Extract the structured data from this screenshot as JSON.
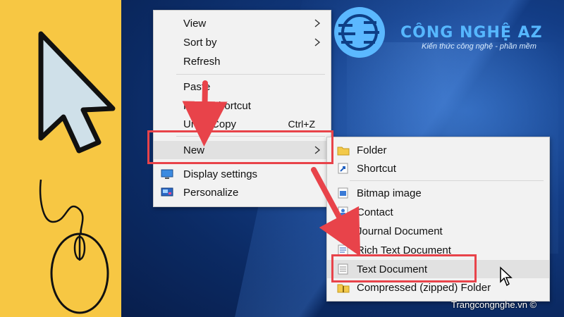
{
  "brand": {
    "name": "CÔNG NGHỆ AZ",
    "tagline": "Kiến thức công nghệ - phần mềm"
  },
  "credit": "Trangcongnghe.vn ©",
  "colors": {
    "left_panel": "#f7c743",
    "desktop": "#133d86",
    "menu_bg": "#f2f2f2",
    "highlight": "#e8434a",
    "logo": "#56b7ff"
  },
  "context_menu": {
    "items": [
      {
        "label": "View",
        "icon": "chevron-right-icon"
      },
      {
        "label": "Sort by",
        "icon": "chevron-right-icon"
      },
      {
        "label": "Refresh"
      },
      {
        "label": "Paste"
      },
      {
        "label": "Paste shortcut"
      },
      {
        "label": "Undo Copy",
        "shortcut": "Ctrl+Z"
      },
      {
        "label": "New",
        "icon": "chevron-right-icon"
      },
      {
        "label": "Display settings",
        "icon": "display-settings-icon"
      },
      {
        "label": "Personalize",
        "icon": "personalize-icon"
      }
    ]
  },
  "submenu": {
    "items": [
      {
        "label": "Folder",
        "icon": "folder-icon"
      },
      {
        "label": "Shortcut",
        "icon": "shortcut-icon"
      },
      {
        "label": "Bitmap image",
        "icon": "bitmap-icon"
      },
      {
        "label": "Contact",
        "icon": "contact-icon"
      },
      {
        "label": "Journal Document",
        "icon": "journal-icon"
      },
      {
        "label": "Rich Text Document",
        "icon": "rich-text-icon"
      },
      {
        "label": "Text Document",
        "icon": "text-document-icon"
      },
      {
        "label": "Compressed (zipped) Folder",
        "icon": "zip-folder-icon"
      }
    ]
  }
}
